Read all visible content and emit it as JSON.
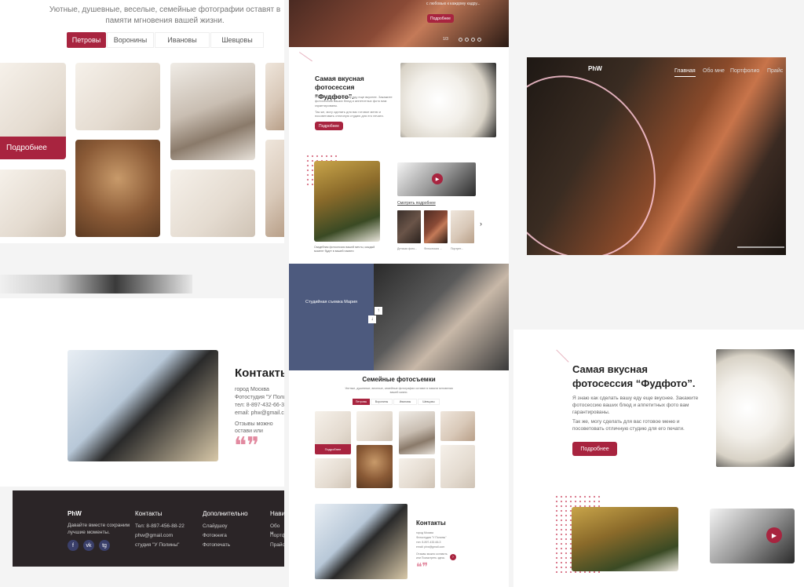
{
  "family_section": {
    "subtitle": "Уютные, душевные, веселые, семейные фотографии оставят в памяти мгновения вашей жизни.",
    "tabs": [
      "Петровы",
      "Воронины",
      "Ивановы",
      "Шевцовы"
    ],
    "more_button": "Подробнее"
  },
  "top_banner": {
    "caption": "с любовью к каждому кадру...",
    "button": "Подробнее",
    "counter": "1/3"
  },
  "mid_column": {
    "session_title": "Самая вкусная фотосессия “Фудфото”.",
    "session_text1": "Я знаю как сделать вашу еду еще вкуснее. Закажите фотосессию ваших блюд и аппетитных фото вам гарантированы.",
    "session_text2": "Так же, могу сделать для вас готовое меню и посоветовать отличную студию для его печати.",
    "session_button": "Подробнее",
    "video_link": "Смотреть подробнее",
    "bride_caption": "Свадебная фотосессия вашей мечты, каждый момент будет в вашей памяти",
    "thumb_captions": [
      "Детская фото...",
      "Фотосессия ...",
      "Портрет..."
    ],
    "studio_title": "Студийная съемка Мария",
    "family_title": "Семейные фотосъемки",
    "family_sub": "Уютные, душевные, веселые, семейные фотографии оставят в памяти мгновения вашей жизни.",
    "family_tabs": [
      "Петровы",
      "Воронины",
      "Ивановы",
      "Шевцовы"
    ],
    "family_more": "Подробнее",
    "contacts_title": "Контакты",
    "contacts_lines": [
      "город Москва",
      "Фотостудия \"У Полины\"",
      "тел: 8-897-432-66-3",
      "email: phw@gmail.com"
    ],
    "contacts_note": "Отзывы можно оставить или Посмотреть здесь"
  },
  "hero": {
    "logo": "PhW",
    "nav": [
      "Главная",
      "Обо мне",
      "Портфолио",
      "Прайс"
    ]
  },
  "contacts": {
    "title": "Контакты",
    "lines": [
      "город Москва",
      "Фотостудия \"У Полины",
      "тел: 8-897-432-66-3",
      "email: phw@gmail.co"
    ],
    "note": "Отзывы можно остави или Посмотреть здесь"
  },
  "footer": {
    "logo": "PhW",
    "tagline": "Давайте вместе сохраним лучшие моменты.",
    "col1_title": "Контакты",
    "col1_items": [
      "Тел: 8-897-456-88-22",
      "phw@gmail.com",
      "студия \"У Полины\""
    ],
    "col2_title": "Дополнительно",
    "col2_items": [
      "Слайдшоу",
      "Фотокнига",
      "Фотопечать"
    ],
    "col3_title": "Нави",
    "col3_items": [
      "Обо м",
      "Портф",
      "Прайс"
    ],
    "social": [
      "f",
      "vk",
      "tg"
    ]
  },
  "food_right": {
    "title": "Самая вкусная фотосессия “Фудфото”.",
    "text1": "Я знаю как сделать вашу еду еще вкуснее. Закажите фотосессию ваших блюд и аппетитных фото вам гарантированы.",
    "text2": "Так же, могу сделать для вас готовое меню и посоветовать отличную студию для его печати.",
    "button": "Подробнее"
  },
  "colors": {
    "accent": "#a8243f",
    "footer_bg": "#2b2527",
    "studio_blue": "#4d5a7e"
  }
}
